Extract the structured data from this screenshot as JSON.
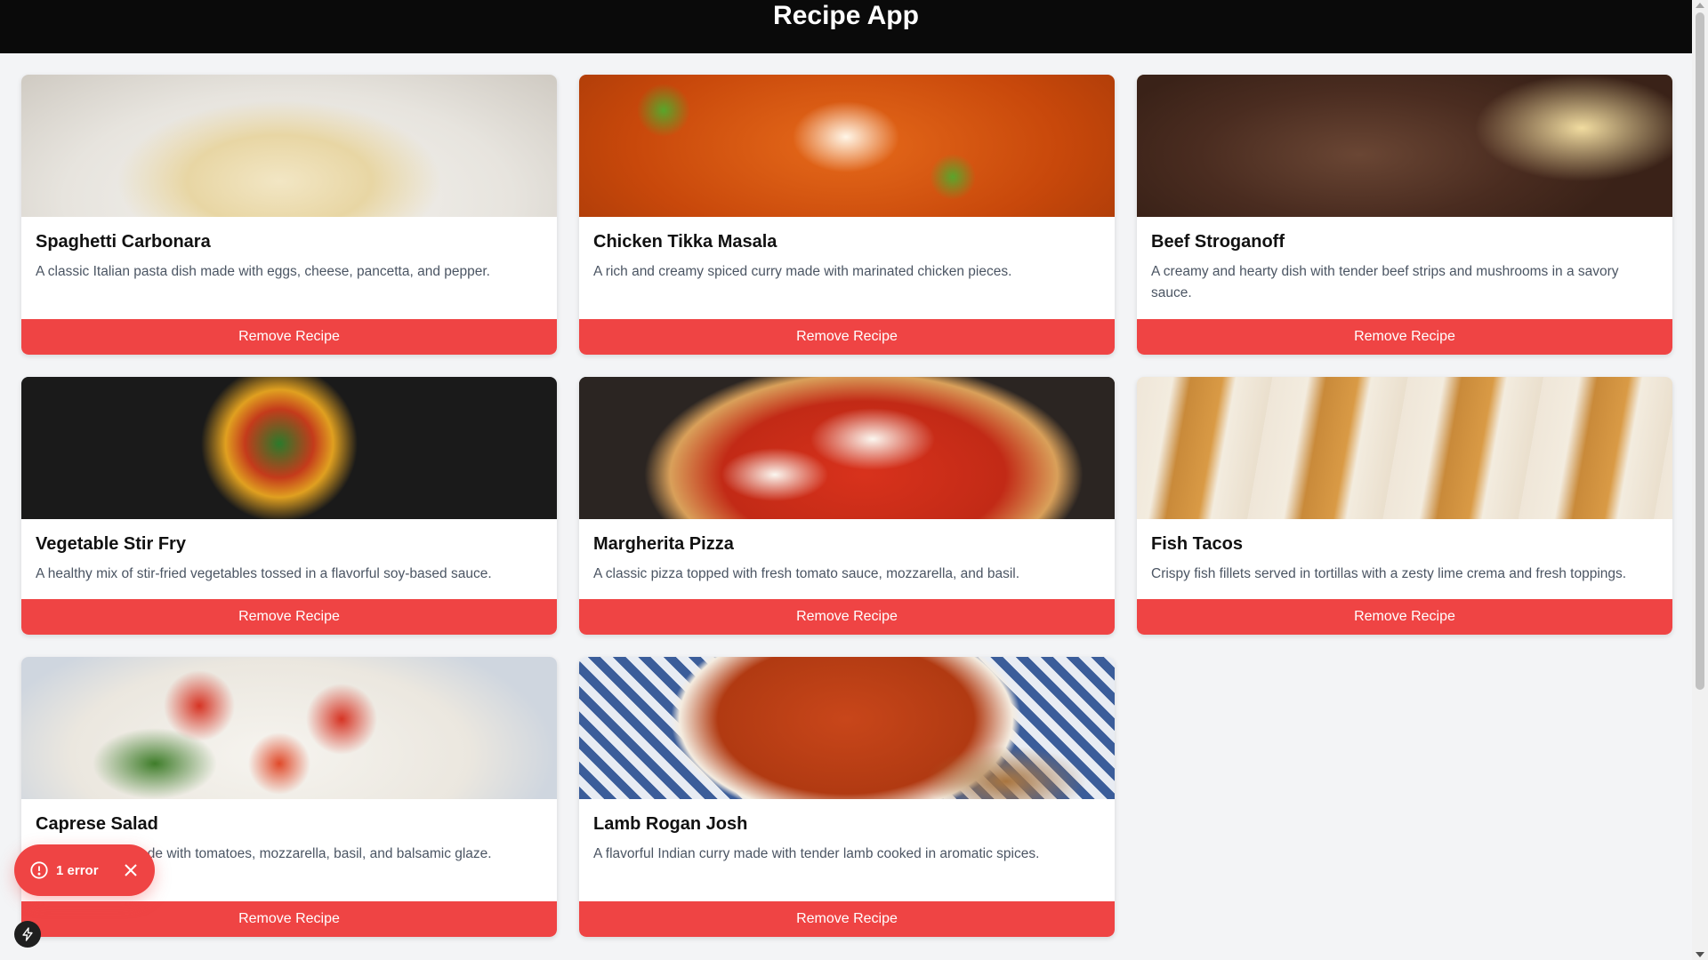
{
  "app": {
    "title": "Recipe App"
  },
  "recipes": [
    {
      "title": "Spaghetti Carbonara",
      "description": "A classic Italian pasta dish made with eggs, cheese, pancetta, and pepper.",
      "button": "Remove Recipe",
      "image": "spaghetti-carbonara-photo"
    },
    {
      "title": "Chicken Tikka Masala",
      "description": "A rich and creamy spiced curry made with marinated chicken pieces.",
      "button": "Remove Recipe",
      "image": "chicken-tikka-masala-photo"
    },
    {
      "title": "Beef Stroganoff",
      "description": "A creamy and hearty dish with tender beef strips and mushrooms in a savory sauce.",
      "button": "Remove Recipe",
      "image": "beef-stroganoff-photo"
    },
    {
      "title": "Vegetable Stir Fry",
      "description": "A healthy mix of stir-fried vegetables tossed in a flavorful soy-based sauce.",
      "button": "Remove Recipe",
      "image": "vegetable-stir-fry-photo"
    },
    {
      "title": "Margherita Pizza",
      "description": "A classic pizza topped with fresh tomato sauce, mozzarella, and basil.",
      "button": "Remove Recipe",
      "image": "margherita-pizza-photo"
    },
    {
      "title": "Fish Tacos",
      "description": "Crispy fish fillets served in tortillas with a zesty lime crema and fresh toppings.",
      "button": "Remove Recipe",
      "image": "fish-tacos-photo"
    },
    {
      "title": "Caprese Salad",
      "description": "A simple salad made with tomatoes, mozzarella, basil, and balsamic glaze.",
      "button": "Remove Recipe",
      "image": "caprese-salad-photo"
    },
    {
      "title": "Lamb Rogan Josh",
      "description": "A flavorful Indian curry made with tender lamb cooked in aromatic spices.",
      "button": "Remove Recipe",
      "image": "lamb-rogan-josh-photo"
    }
  ],
  "error_indicator": {
    "label": "1 error",
    "icon": "alert-circle-icon",
    "close_icon": "close-icon"
  },
  "dev_tools": {
    "icon": "lightning-bolt-icon"
  },
  "colors": {
    "header_bg": "#0a0a0a",
    "page_bg": "#f3f4f6",
    "accent_red": "#ef4444",
    "card_bg": "#ffffff"
  }
}
